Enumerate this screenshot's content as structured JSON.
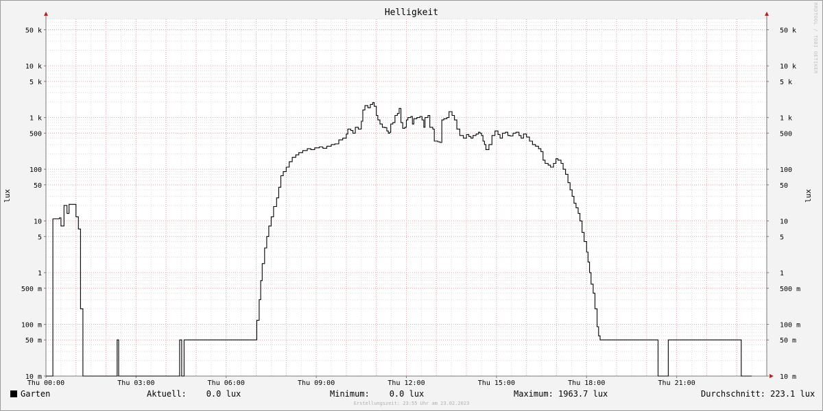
{
  "chart_data": {
    "type": "line",
    "title": "Helligkeit",
    "ylabel": "lux",
    "y_scale": "log",
    "ylim": [
      0.01,
      80000
    ],
    "xlim": [
      0,
      24
    ],
    "x_unit": "hours",
    "x_ticks": [
      {
        "x": 0,
        "label": "Thu 00:00"
      },
      {
        "x": 3,
        "label": "Thu 03:00"
      },
      {
        "x": 6,
        "label": "Thu 06:00"
      },
      {
        "x": 9,
        "label": "Thu 09:00"
      },
      {
        "x": 12,
        "label": "Thu 12:00"
      },
      {
        "x": 15,
        "label": "Thu 15:00"
      },
      {
        "x": 18,
        "label": "Thu 18:00"
      },
      {
        "x": 21,
        "label": "Thu 21:00"
      }
    ],
    "y_ticks": [
      {
        "y": 0.01,
        "label": "10 m"
      },
      {
        "y": 0.05,
        "label": "50 m"
      },
      {
        "y": 0.1,
        "label": "100 m"
      },
      {
        "y": 0.5,
        "label": "500 m"
      },
      {
        "y": 1,
        "label": "1"
      },
      {
        "y": 5,
        "label": "5"
      },
      {
        "y": 10,
        "label": "10"
      },
      {
        "y": 50,
        "label": "50"
      },
      {
        "y": 100,
        "label": "100"
      },
      {
        "y": 500,
        "label": "500"
      },
      {
        "y": 1000,
        "label": "1 k"
      },
      {
        "y": 5000,
        "label": "5 k"
      },
      {
        "y": 10000,
        "label": "10 k"
      },
      {
        "y": 50000,
        "label": "50 k"
      }
    ],
    "grid": true,
    "series": [
      {
        "name": "Garten",
        "color": "#000000",
        "points": [
          [
            0.0,
            0.01
          ],
          [
            0.22,
            0.01
          ],
          [
            0.23,
            11
          ],
          [
            0.45,
            11.5
          ],
          [
            0.5,
            8
          ],
          [
            0.57,
            8
          ],
          [
            0.6,
            20
          ],
          [
            0.67,
            20
          ],
          [
            0.7,
            14
          ],
          [
            0.73,
            14
          ],
          [
            0.77,
            21
          ],
          [
            0.95,
            21
          ],
          [
            1.0,
            12
          ],
          [
            1.05,
            12
          ],
          [
            1.08,
            7
          ],
          [
            1.12,
            7
          ],
          [
            1.15,
            0.2
          ],
          [
            1.2,
            0.2
          ],
          [
            1.23,
            0.01
          ],
          [
            2.35,
            0.01
          ],
          [
            2.37,
            0.05
          ],
          [
            2.4,
            0.05
          ],
          [
            2.42,
            0.01
          ],
          [
            4.42,
            0.01
          ],
          [
            4.45,
            0.05
          ],
          [
            4.5,
            0.05
          ],
          [
            4.52,
            0.01
          ],
          [
            4.57,
            0.01
          ],
          [
            4.6,
            0.05
          ],
          [
            6.0,
            0.05
          ],
          [
            7.0,
            0.05
          ],
          [
            7.02,
            0.12
          ],
          [
            7.1,
            0.3
          ],
          [
            7.15,
            0.7
          ],
          [
            7.2,
            1.5
          ],
          [
            7.28,
            3
          ],
          [
            7.35,
            5
          ],
          [
            7.42,
            8
          ],
          [
            7.5,
            12
          ],
          [
            7.58,
            19
          ],
          [
            7.68,
            28
          ],
          [
            7.75,
            45
          ],
          [
            7.82,
            75
          ],
          [
            7.9,
            90
          ],
          [
            8.0,
            110
          ],
          [
            8.1,
            140
          ],
          [
            8.2,
            170
          ],
          [
            8.32,
            190
          ],
          [
            8.42,
            210
          ],
          [
            8.55,
            230
          ],
          [
            8.7,
            250
          ],
          [
            8.82,
            240
          ],
          [
            8.95,
            260
          ],
          [
            9.1,
            270
          ],
          [
            9.22,
            255
          ],
          [
            9.35,
            280
          ],
          [
            9.5,
            300
          ],
          [
            9.62,
            310
          ],
          [
            9.75,
            370
          ],
          [
            9.88,
            400
          ],
          [
            10.0,
            480
          ],
          [
            10.05,
            600
          ],
          [
            10.15,
            560
          ],
          [
            10.22,
            500
          ],
          [
            10.3,
            650
          ],
          [
            10.4,
            600
          ],
          [
            10.5,
            850
          ],
          [
            10.55,
            1400
          ],
          [
            10.62,
            1700
          ],
          [
            10.72,
            1550
          ],
          [
            10.8,
            1800
          ],
          [
            10.88,
            1950
          ],
          [
            10.93,
            1650
          ],
          [
            11.0,
            1100
          ],
          [
            11.05,
            900
          ],
          [
            11.12,
            750
          ],
          [
            11.2,
            650
          ],
          [
            11.28,
            640
          ],
          [
            11.35,
            550
          ],
          [
            11.4,
            500
          ],
          [
            11.45,
            520
          ],
          [
            11.48,
            750
          ],
          [
            11.55,
            800
          ],
          [
            11.62,
            1100
          ],
          [
            11.7,
            1200
          ],
          [
            11.76,
            1500
          ],
          [
            11.82,
            800
          ],
          [
            11.88,
            620
          ],
          [
            11.95,
            650
          ],
          [
            12.0,
            900
          ],
          [
            12.05,
            1000
          ],
          [
            12.15,
            1050
          ],
          [
            12.2,
            750
          ],
          [
            12.25,
            950
          ],
          [
            12.35,
            1000
          ],
          [
            12.45,
            1050
          ],
          [
            12.52,
            900
          ],
          [
            12.58,
            650
          ],
          [
            12.62,
            1000
          ],
          [
            12.72,
            1100
          ],
          [
            12.78,
            650
          ],
          [
            12.88,
            600
          ],
          [
            12.93,
            350
          ],
          [
            13.05,
            340
          ],
          [
            13.12,
            330
          ],
          [
            13.18,
            900
          ],
          [
            13.25,
            950
          ],
          [
            13.35,
            1000
          ],
          [
            13.42,
            1300
          ],
          [
            13.52,
            1100
          ],
          [
            13.6,
            900
          ],
          [
            13.68,
            600
          ],
          [
            13.78,
            450
          ],
          [
            13.9,
            400
          ],
          [
            14.0,
            470
          ],
          [
            14.08,
            430
          ],
          [
            14.15,
            400
          ],
          [
            14.22,
            450
          ],
          [
            14.32,
            480
          ],
          [
            14.4,
            520
          ],
          [
            14.45,
            500
          ],
          [
            14.5,
            450
          ],
          [
            14.55,
            350
          ],
          [
            14.6,
            300
          ],
          [
            14.65,
            240
          ],
          [
            14.75,
            300
          ],
          [
            14.85,
            450
          ],
          [
            14.95,
            550
          ],
          [
            15.05,
            470
          ],
          [
            15.12,
            400
          ],
          [
            15.2,
            500
          ],
          [
            15.3,
            520
          ],
          [
            15.38,
            450
          ],
          [
            15.45,
            440
          ],
          [
            15.55,
            500
          ],
          [
            15.65,
            520
          ],
          [
            15.75,
            450
          ],
          [
            15.82,
            400
          ],
          [
            15.9,
            480
          ],
          [
            16.0,
            420
          ],
          [
            16.1,
            350
          ],
          [
            16.2,
            300
          ],
          [
            16.3,
            280
          ],
          [
            16.4,
            250
          ],
          [
            16.48,
            220
          ],
          [
            16.55,
            150
          ],
          [
            16.62,
            130
          ],
          [
            16.72,
            120
          ],
          [
            16.8,
            110
          ],
          [
            16.9,
            130
          ],
          [
            16.98,
            160
          ],
          [
            17.05,
            150
          ],
          [
            17.15,
            130
          ],
          [
            17.22,
            100
          ],
          [
            17.3,
            80
          ],
          [
            17.38,
            55
          ],
          [
            17.45,
            40
          ],
          [
            17.52,
            30
          ],
          [
            17.58,
            22
          ],
          [
            17.65,
            18
          ],
          [
            17.72,
            14
          ],
          [
            17.78,
            10
          ],
          [
            17.85,
            6
          ],
          [
            17.92,
            4
          ],
          [
            18.0,
            2.5
          ],
          [
            18.05,
            1.6
          ],
          [
            18.1,
            1
          ],
          [
            18.15,
            0.6
          ],
          [
            18.22,
            0.4
          ],
          [
            18.28,
            0.2
          ],
          [
            18.35,
            0.09
          ],
          [
            18.4,
            0.06
          ],
          [
            18.45,
            0.05
          ],
          [
            19.0,
            0.05
          ],
          [
            20.35,
            0.05
          ],
          [
            20.38,
            0.01
          ],
          [
            20.7,
            0.01
          ],
          [
            20.72,
            0.05
          ],
          [
            23.12,
            0.05
          ],
          [
            23.15,
            0.01
          ],
          [
            23.5,
            0.01
          ]
        ]
      }
    ]
  },
  "legend": {
    "series_name": "Garten",
    "current": "Aktuell:    0.0 lux",
    "minimum": "Minimum:    0.0 lux",
    "maximum": "Maximum: 1963.7 lux",
    "average": "Durchschnitt: 223.1 lux"
  },
  "watermark": "RRDTOOL / TOBI OETIKER",
  "footer": "Erstellungszeit: 23:55 Uhr am 23.02.2023",
  "colors": {
    "major_grid": "#e3a5a5",
    "minor_grid": "#dcdcdc",
    "axis": "#7a7a7a",
    "arrow": "#b22222",
    "line": "#000000"
  }
}
